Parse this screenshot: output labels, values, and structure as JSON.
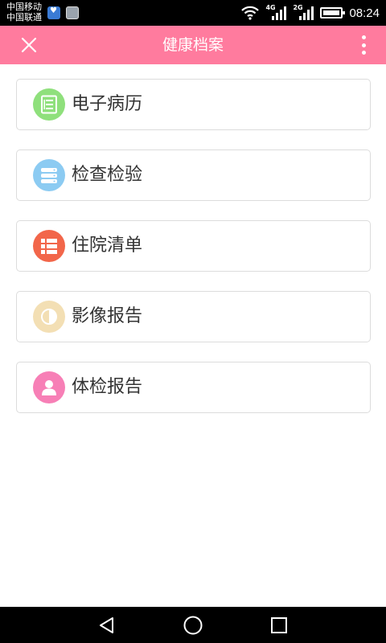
{
  "status_bar": {
    "carrier_1": "中国移动",
    "carrier_2": "中国联通",
    "network_1": "4G",
    "network_2": "2G",
    "time": "08:24"
  },
  "app_bar": {
    "title": "健康档案",
    "close_icon": "close-icon",
    "more_icon": "more-vertical-icon"
  },
  "menu": {
    "items": [
      {
        "label": "电子病历",
        "icon": "medical-record-icon",
        "color": "#8fe07c"
      },
      {
        "label": "检查检验",
        "icon": "server-stack-icon",
        "color": "#8ccbf2"
      },
      {
        "label": "住院清单",
        "icon": "list-icon",
        "color": "#f2664a"
      },
      {
        "label": "影像报告",
        "icon": "contrast-icon",
        "color": "#f3dfb4"
      },
      {
        "label": "体检报告",
        "icon": "person-icon",
        "color": "#f77fb6"
      }
    ]
  },
  "colors": {
    "app_bar": "#ff7b9e",
    "status_bar": "#000000",
    "nav_bar": "#000000",
    "card_border": "#dcdcdc"
  }
}
